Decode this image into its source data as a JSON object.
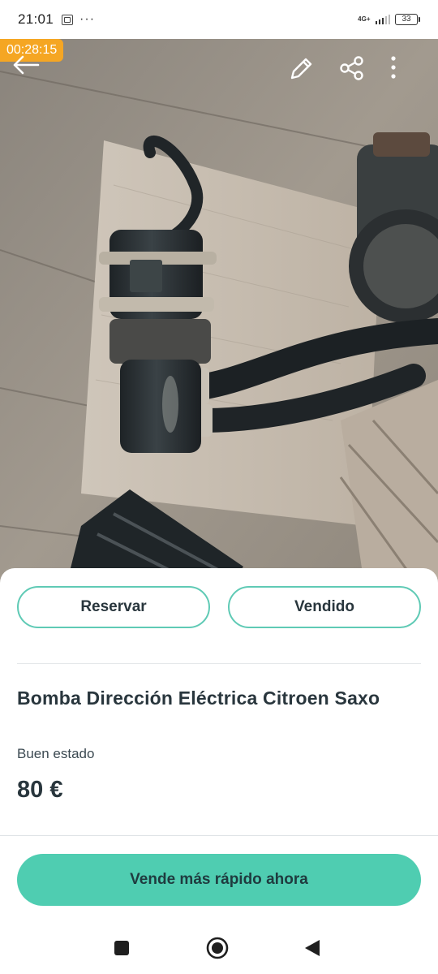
{
  "status_bar": {
    "time": "21:01",
    "more": "···",
    "network": "4G+",
    "battery": "33",
    "icons": [
      "screen-record-icon",
      "signal-icon",
      "battery-icon"
    ]
  },
  "recording_timer": "00:28:15",
  "toolbar": {
    "icons": [
      "back-arrow-icon",
      "edit-pencil-icon",
      "share-icon",
      "more-vertical-icon"
    ]
  },
  "actions": {
    "reserve_label": "Reservar",
    "sold_label": "Vendido"
  },
  "product": {
    "title": "Bomba Dirección Eléctrica Citroen Saxo",
    "condition": "Buen estado",
    "price": "80 €"
  },
  "cta": {
    "label": "Vende más rápido ahora"
  },
  "colors": {
    "accent": "#4fcdb1",
    "outline": "#5fcab5",
    "text": "#29363d",
    "timer_badge": "#f5a623"
  },
  "nav_bar": {
    "icons": [
      "recents-square-icon",
      "home-circle-icon",
      "back-triangle-icon"
    ]
  }
}
